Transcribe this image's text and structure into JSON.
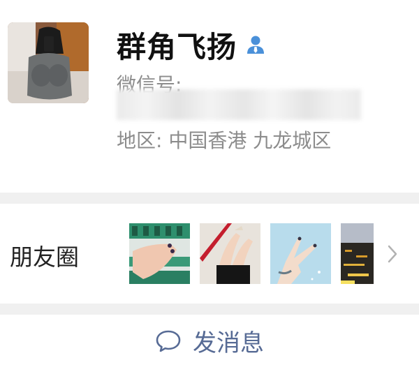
{
  "profile": {
    "name": "群角飞扬",
    "wechat_id_label": "微信号:",
    "region_text": "地区: 中国香港  九龙城区",
    "avatar_icon": "profile-photo",
    "contact_icon": "person-icon"
  },
  "moments": {
    "label": "朋友圈",
    "thumbnails": [
      "nail-polish-photo",
      "legs-heels-photo",
      "hand-peace-sign-photo",
      "night-scene-photo"
    ],
    "chevron_icon": "chevron-right-icon"
  },
  "actions": {
    "message_label": "发消息",
    "message_icon": "chat-bubble-icon"
  },
  "colors": {
    "link_blue": "#576b95",
    "secondary_gray": "#8c8c8c",
    "background": "#f0f0f0",
    "contact_icon_blue": "#4a90d9"
  }
}
